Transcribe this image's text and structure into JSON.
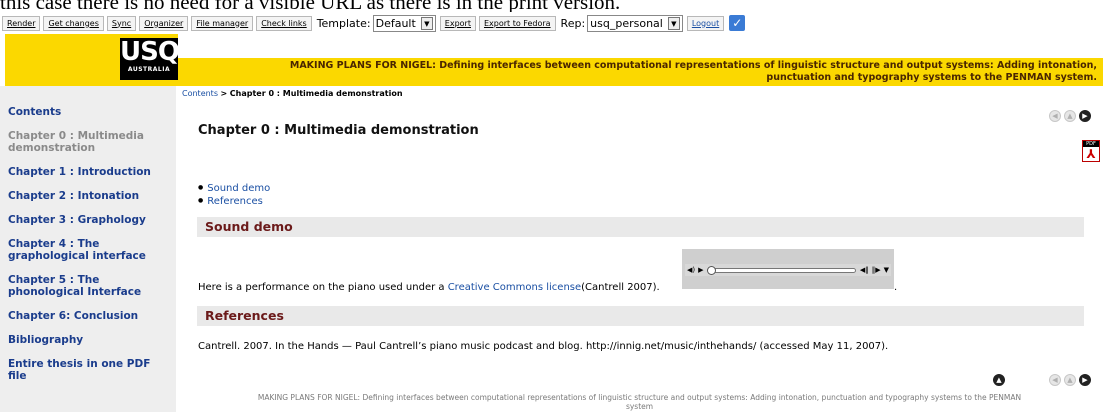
{
  "caption": "this case there is no need for a visible URL as there is in the print version.",
  "toolbar": {
    "buttons": [
      "Render",
      "Get changes",
      "Sync",
      "Organizer",
      "File manager",
      "Check links"
    ],
    "template_label": "Template:",
    "template_value": "Default",
    "export_buttons": [
      "Export",
      "Export to Fedora"
    ],
    "rep_label": "Rep:",
    "rep_value": "usq_personal",
    "logout": "Logout",
    "checkmark": "✓"
  },
  "logo": {
    "main": "USQ",
    "sub": "AUSTRALIA"
  },
  "title_line1": "MAKING PLANS FOR NIGEL: Defining interfaces between computational representations of linguistic structure and output systems: Adding intonation,",
  "title_line2": "punctuation and typography systems to the PENMAN system.",
  "breadcrumb": {
    "link": "Contents",
    "sep": ">",
    "current": "Chapter 0 : Multimedia demonstration"
  },
  "sidebar": {
    "items": [
      "Contents",
      "Chapter 0 : Multimedia demonstration",
      "Chapter 1 : Introduction",
      "Chapter 2 : Intonation",
      "Chapter 3 : Graphology",
      "Chapter 4 : The graphological interface",
      "Chapter 5 : The phonological Interface",
      "Chapter 6: Conclusion",
      "Bibliography",
      "Entire thesis in one PDF file"
    ]
  },
  "chapter_title": "Chapter 0 : Multimedia demonstration",
  "pdf_label": "PDF",
  "toc": [
    "Sound demo",
    "References"
  ],
  "sections": {
    "sound": "Sound demo",
    "refs": "References"
  },
  "performance": {
    "prefix": "Here is a performance on the piano used under a ",
    "link": "Creative Commons license",
    "suffix": "(Cantrell 2007).",
    "end": "."
  },
  "reference_text": "Cantrell. 2007. In the Hands — Paul Cantrell’s piano music podcast and blog. http://innig.net/music/inthehands/ (accessed May 11, 2007).",
  "footer_line1": "MAKING PLANS FOR NIGEL: Defining interfaces between computational representations of linguistic structure and output systems: Adding intonation, punctuation and typography systems to the PENMAN",
  "footer_line2": "system"
}
